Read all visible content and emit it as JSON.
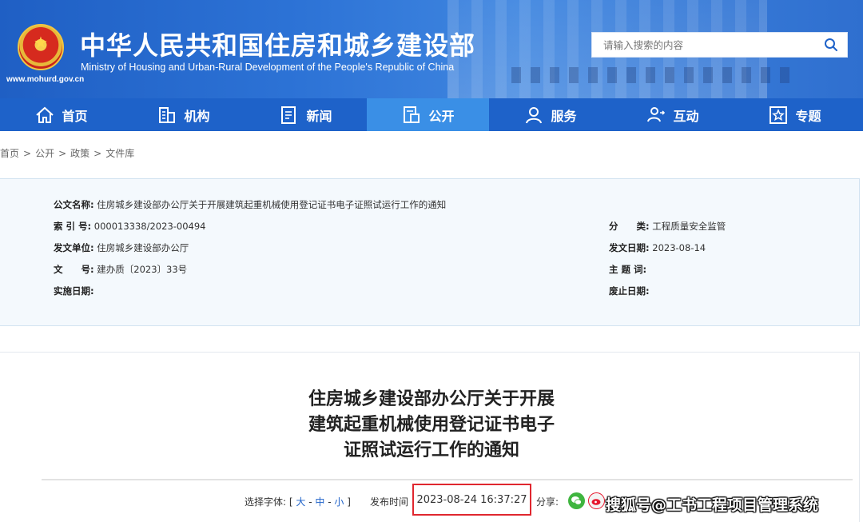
{
  "header": {
    "title_cn": "中华人民共和国住房和城乡建设部",
    "title_en": "Ministry of Housing and Urban-Rural Development of the People's Republic of China",
    "url": "www.mohurd.gov.cn",
    "search_placeholder": "请输入搜索的内容"
  },
  "nav": {
    "items": [
      {
        "label": "首页",
        "icon": "home-icon"
      },
      {
        "label": "机构",
        "icon": "building-icon"
      },
      {
        "label": "新闻",
        "icon": "news-icon"
      },
      {
        "label": "公开",
        "icon": "document-icon"
      },
      {
        "label": "服务",
        "icon": "person-service-icon"
      },
      {
        "label": "互动",
        "icon": "interaction-icon"
      },
      {
        "label": "专题",
        "icon": "star-icon"
      }
    ],
    "active": "公开"
  },
  "breadcrumb": [
    "首页",
    "公开",
    "政策",
    "文件库"
  ],
  "meta": {
    "name_label": "公文名称:",
    "name_value": "住房城乡建设部办公厅关于开展建筑起重机械使用登记证书电子证照试运行工作的通知",
    "index_label": "索 引 号:",
    "index_value": "000013338/2023-00494",
    "issuer_label": "发文单位:",
    "issuer_value": "住房城乡建设部办公厅",
    "docno_label": "文　　号:",
    "docno_value": "建办质〔2023〕33号",
    "impl_label": "实施日期:",
    "impl_value": "",
    "category_label": "分　　类:",
    "category_value": "工程质量安全监管",
    "issue_date_label": "发文日期:",
    "issue_date_value": "2023-08-14",
    "subject_label": "主 题 词:",
    "subject_value": "",
    "expire_label": "废止日期:",
    "expire_value": ""
  },
  "article": {
    "title_lines": [
      "住房城乡建设部办公厅关于开展",
      "建筑起重机械使用登记证书电子",
      "证照试运行工作的通知"
    ],
    "font_label": "选择字体:",
    "font_open": "[",
    "font_large": "大",
    "font_medium": "中",
    "font_small": "小",
    "font_close": "]",
    "font_sep": "-",
    "pub_label": "发布时间",
    "pub_time": "2023-08-24 16:37:27",
    "share_label": "分享:",
    "watermark": "搜狐号@工书工程项目管理系统"
  },
  "colors": {
    "brand_blue": "#1e62c9",
    "nav_active": "#3a8fe6",
    "highlight_red": "#e0272f",
    "meta_bg": "#f4f9fd"
  }
}
